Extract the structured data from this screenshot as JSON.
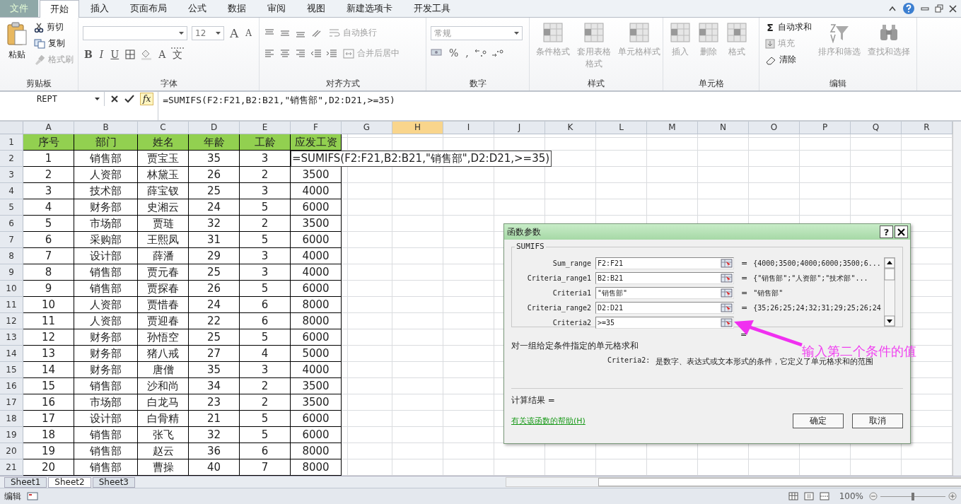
{
  "menu_tabs": [
    {
      "label": "文件",
      "kind": "file",
      "selected": false
    },
    {
      "label": "开始",
      "kind": "tab",
      "selected": true
    },
    {
      "label": "插入",
      "kind": "tab",
      "selected": false
    },
    {
      "label": "页面布局",
      "kind": "tab",
      "selected": false
    },
    {
      "label": "公式",
      "kind": "tab",
      "selected": false
    },
    {
      "label": "数据",
      "kind": "tab",
      "selected": false
    },
    {
      "label": "审阅",
      "kind": "tab",
      "selected": false
    },
    {
      "label": "视图",
      "kind": "tab",
      "selected": false
    },
    {
      "label": "新建选项卡",
      "kind": "tab",
      "selected": false
    },
    {
      "label": "开发工具",
      "kind": "tab",
      "selected": false
    }
  ],
  "ribbon": [
    {
      "title": "剪贴板",
      "controls": [
        {
          "label": "粘贴",
          "disabled": false
        },
        {
          "label": "剪切",
          "disabled": false
        },
        {
          "label": "复制",
          "disabled": false
        },
        {
          "label": "格式刷",
          "disabled": true
        }
      ]
    },
    {
      "title": "字体",
      "font_size": "12",
      "glyphs": [
        "A",
        "A",
        "B",
        "I",
        "U",
        "A",
        "文"
      ]
    },
    {
      "title": "对齐方式",
      "controls": [
        {
          "label": "自动换行",
          "disabled": true
        },
        {
          "label": "合并后居中",
          "disabled": true
        }
      ]
    },
    {
      "title": "数字",
      "number_format": "常规",
      "glyphs": [
        "%",
        ","
      ]
    },
    {
      "title": "样式",
      "controls": [
        {
          "label": "条件格式",
          "disabled": true
        },
        {
          "label": "套用表格格式",
          "disabled": true
        },
        {
          "label": "单元格样式",
          "disabled": true
        }
      ]
    },
    {
      "title": "单元格",
      "controls": [
        {
          "label": "插入",
          "disabled": true
        },
        {
          "label": "删除",
          "disabled": true
        },
        {
          "label": "格式",
          "disabled": true
        }
      ]
    },
    {
      "title": "编辑",
      "glyphs": [
        "Σ"
      ],
      "controls": [
        {
          "label": "自动求和",
          "disabled": false
        },
        {
          "label": "填充",
          "disabled": true
        },
        {
          "label": "清除",
          "disabled": false
        },
        {
          "label": "排序和筛选",
          "disabled": true
        },
        {
          "label": "查找和选择",
          "disabled": true
        }
      ]
    }
  ],
  "formula_bar": {
    "name_box": "REPT",
    "fx": "fx",
    "formula": "=SUMIFS(F2:F21,B2:B21,\"销售部\",D2:D21,>=35)"
  },
  "sheet": {
    "columns": [
      {
        "label": "A",
        "selected": false
      },
      {
        "label": "B",
        "selected": false
      },
      {
        "label": "C",
        "selected": false
      },
      {
        "label": "D",
        "selected": false
      },
      {
        "label": "E",
        "selected": false
      },
      {
        "label": "F",
        "selected": false
      },
      {
        "label": "G",
        "selected": false
      },
      {
        "label": "H",
        "selected": true
      },
      {
        "label": "I",
        "selected": false
      },
      {
        "label": "J",
        "selected": false
      },
      {
        "label": "K",
        "selected": false
      },
      {
        "label": "L",
        "selected": false
      },
      {
        "label": "M",
        "selected": false
      },
      {
        "label": "N",
        "selected": false
      },
      {
        "label": "O",
        "selected": false
      },
      {
        "label": "P",
        "selected": false
      },
      {
        "label": "Q",
        "selected": false
      },
      {
        "label": "R",
        "selected": false
      }
    ],
    "rows": [
      {
        "number": "1",
        "kind": "header",
        "cells": [
          "序号",
          "部门",
          "姓名",
          "年龄",
          "工龄",
          "应发工资"
        ]
      },
      {
        "number": "2",
        "kind": "editing",
        "cells": [
          "1",
          "销售部",
          "贾宝玉",
          "35",
          "3",
          "=SUMIFS(F2:F21,B2:B21,\"销售部\",D2:D21,>=35)"
        ]
      },
      {
        "number": "3",
        "kind": "data",
        "cells": [
          "2",
          "人资部",
          "林黛玉",
          "26",
          "2",
          "3500"
        ]
      },
      {
        "number": "4",
        "kind": "data",
        "cells": [
          "3",
          "技术部",
          "薛宝钗",
          "25",
          "3",
          "4000"
        ]
      },
      {
        "number": "5",
        "kind": "data",
        "cells": [
          "4",
          "财务部",
          "史湘云",
          "24",
          "5",
          "6000"
        ]
      },
      {
        "number": "6",
        "kind": "data",
        "cells": [
          "5",
          "市场部",
          "贾琏",
          "32",
          "2",
          "3500"
        ]
      },
      {
        "number": "7",
        "kind": "data",
        "cells": [
          "6",
          "采购部",
          "王熙凤",
          "31",
          "5",
          "6000"
        ]
      },
      {
        "number": "8",
        "kind": "data",
        "cells": [
          "7",
          "设计部",
          "薛潘",
          "29",
          "3",
          "4000"
        ]
      },
      {
        "number": "9",
        "kind": "data",
        "cells": [
          "8",
          "销售部",
          "贾元春",
          "25",
          "3",
          "4000"
        ]
      },
      {
        "number": "10",
        "kind": "data",
        "cells": [
          "9",
          "销售部",
          "贾探春",
          "26",
          "5",
          "6000"
        ]
      },
      {
        "number": "11",
        "kind": "data",
        "cells": [
          "10",
          "人资部",
          "贾惜春",
          "24",
          "6",
          "8000"
        ]
      },
      {
        "number": "12",
        "kind": "data",
        "cells": [
          "11",
          "人资部",
          "贾迎春",
          "22",
          "6",
          "8000"
        ]
      },
      {
        "number": "13",
        "kind": "data",
        "cells": [
          "12",
          "财务部",
          "孙悟空",
          "25",
          "5",
          "6000"
        ]
      },
      {
        "number": "14",
        "kind": "data",
        "cells": [
          "13",
          "财务部",
          "猪八戒",
          "27",
          "4",
          "5000"
        ]
      },
      {
        "number": "15",
        "kind": "data",
        "cells": [
          "14",
          "财务部",
          "唐僧",
          "35",
          "3",
          "4000"
        ]
      },
      {
        "number": "16",
        "kind": "data",
        "cells": [
          "15",
          "销售部",
          "沙和尚",
          "34",
          "2",
          "3500"
        ]
      },
      {
        "number": "17",
        "kind": "data",
        "cells": [
          "16",
          "市场部",
          "白龙马",
          "23",
          "2",
          "3500"
        ]
      },
      {
        "number": "18",
        "kind": "data",
        "cells": [
          "17",
          "设计部",
          "白骨精",
          "21",
          "5",
          "6000"
        ]
      },
      {
        "number": "19",
        "kind": "data",
        "cells": [
          "18",
          "销售部",
          "张飞",
          "32",
          "5",
          "6000"
        ]
      },
      {
        "number": "20",
        "kind": "data",
        "cells": [
          "19",
          "销售部",
          "赵云",
          "36",
          "6",
          "8000"
        ]
      },
      {
        "number": "21",
        "kind": "data",
        "cells": [
          "20",
          "销售部",
          "曹操",
          "40",
          "7",
          "8000"
        ]
      }
    ]
  },
  "sheet_tabs": [
    {
      "label": "Sheet1",
      "selected": false
    },
    {
      "label": "Sheet2",
      "selected": true
    },
    {
      "label": "Sheet3",
      "selected": false
    }
  ],
  "status_bar": {
    "mode": "编辑",
    "zoom": "100%",
    "level": 0.5
  },
  "dialog": {
    "title": "函数参数",
    "help": "?",
    "function": "SUMIFS",
    "arguments": [
      {
        "name": "Sum_range",
        "value": "F2:F21",
        "equals": "=",
        "result": "{4000;3500;4000;6000;3500;6..."
      },
      {
        "name": "Criteria_range1",
        "value": "B2:B21",
        "equals": "=",
        "result": "{\"销售部\";\"人资部\";\"技术部\"..."
      },
      {
        "name": "Criteria1",
        "value": "\"销售部\"",
        "equals": "=",
        "result": "\"销售部\""
      },
      {
        "name": "Criteria_range2",
        "value": "D2:D21",
        "equals": "=",
        "result": "{35;26;25;24;32;31;29;25;26;24"
      },
      {
        "name": "Criteria2",
        "value": ">=35"
      }
    ],
    "result_sign": "=",
    "description": "对一组给定条件指定的单元格求和",
    "param_name": "Criteria2:",
    "param_help": "是数字、表达式或文本形式的条件，它定义了单元格求和的范围",
    "calc_result": "计算结果 =",
    "help_link": "有关该函数的帮助(H)",
    "buttons": [
      "确定",
      "取消"
    ]
  },
  "annotation": {
    "text": "输入第二个条件的值"
  }
}
